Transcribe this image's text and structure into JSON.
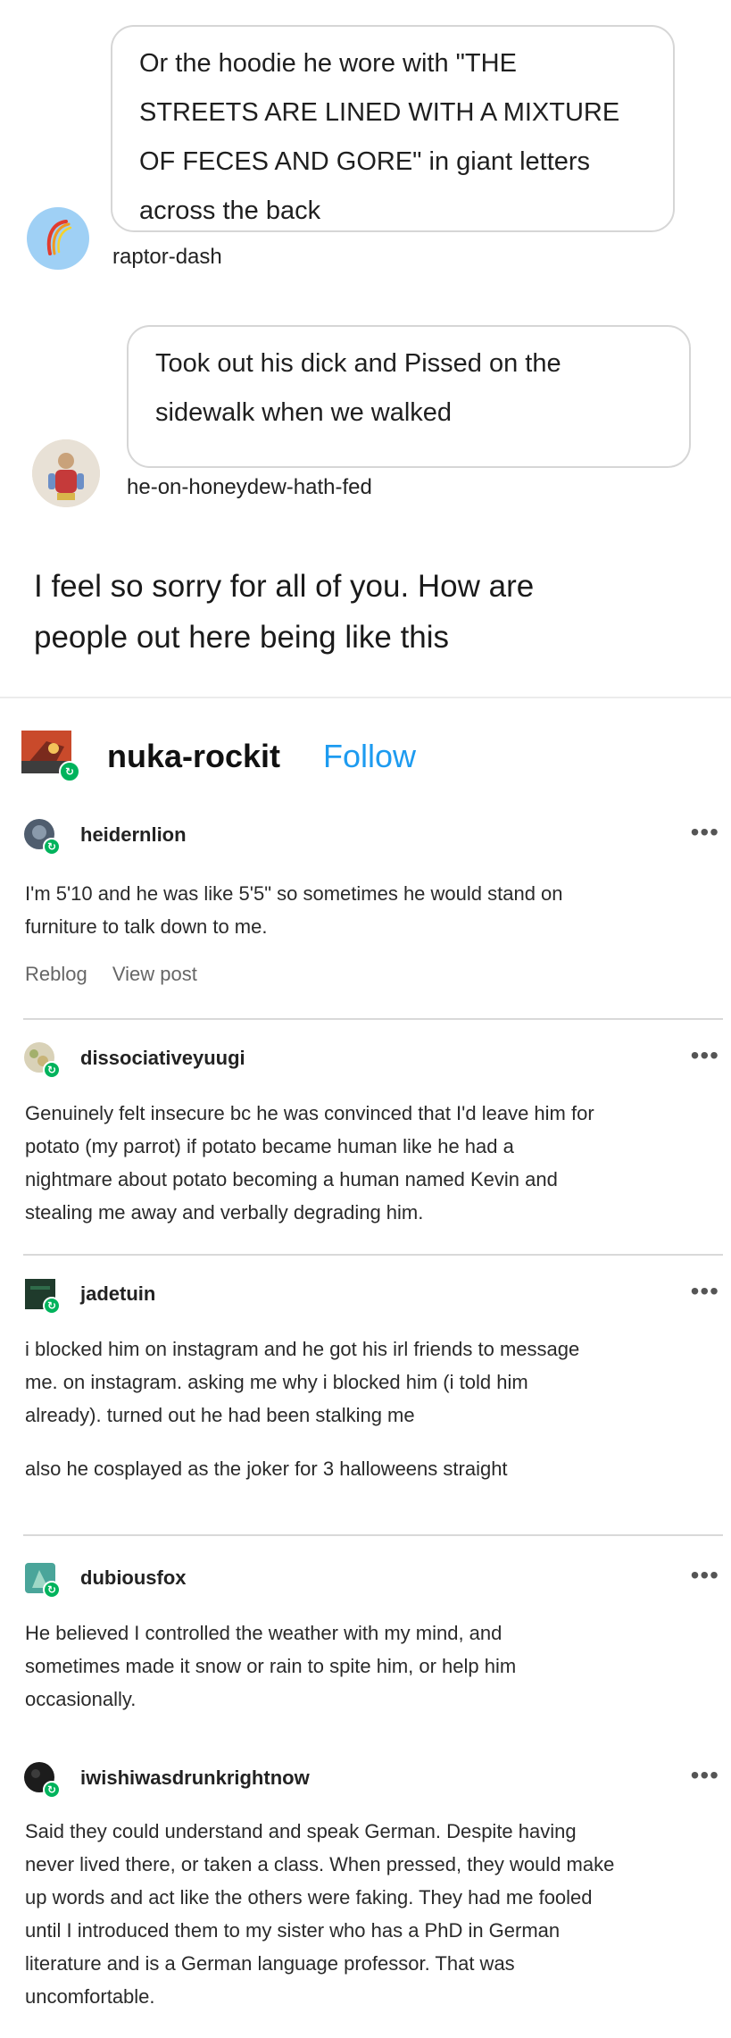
{
  "thread": {
    "bubble1": {
      "lines": [
        "Or the hoodie he wore with \"THE",
        "STREETS ARE LINED WITH A MIXTURE",
        "OF FECES AND GORE\" in giant letters",
        "across the back"
      ],
      "username": "raptor-dash"
    },
    "bubble2": {
      "lines": [
        "Took out his dick and Pissed on the",
        "sidewalk when we walked"
      ],
      "username": "he-on-honeydew-hath-fed"
    },
    "caption": {
      "lines": [
        "I feel so sorry for all of you. How are",
        "people out here being like this"
      ]
    }
  },
  "post": {
    "author": "nuka-rockit",
    "follow_label": "Follow",
    "accent_color": "#1d9bf0"
  },
  "notes": [
    {
      "user": "heidernlion",
      "more": "•••",
      "lines": [
        "I'm 5'10 and he was like 5'5\" so sometimes he would stand on",
        "furniture to talk down to me."
      ],
      "reblog_label": "Reblog",
      "view_label": "View post"
    },
    {
      "user": "dissociativeyuugi",
      "more": "•••",
      "lines": [
        "Genuinely felt insecure bc he was convinced that I'd leave him for",
        "potato (my parrot) if potato became human like he had a",
        "nightmare about potato becoming a human named Kevin and",
        "stealing me away and verbally degrading him."
      ]
    },
    {
      "user": "jadetuin",
      "more": "•••",
      "lines": [
        "i blocked him on instagram and he got his irl friends to message",
        "me. on instagram. asking me why i blocked him (i told him",
        "already). turned out he had been stalking me"
      ],
      "extra": "also he cosplayed as the joker for 3 halloweens straight"
    },
    {
      "user": "dubiousfox",
      "more": "•••",
      "lines": [
        "He believed I controlled the weather with my mind, and",
        "sometimes made it snow or rain to spite him, or help him",
        "occasionally."
      ]
    },
    {
      "user": "iwishiwasdrunkrightnow",
      "more": "•••",
      "lines": [
        "Said they could understand and speak German. Despite having",
        "never lived there, or taken a class. When pressed, they would make",
        "up words and act like the others were faking. They had me fooled",
        "until I introduced them to my sister who has a PhD in German",
        "literature and is a German language professor. That was",
        "uncomfortable."
      ]
    }
  ]
}
